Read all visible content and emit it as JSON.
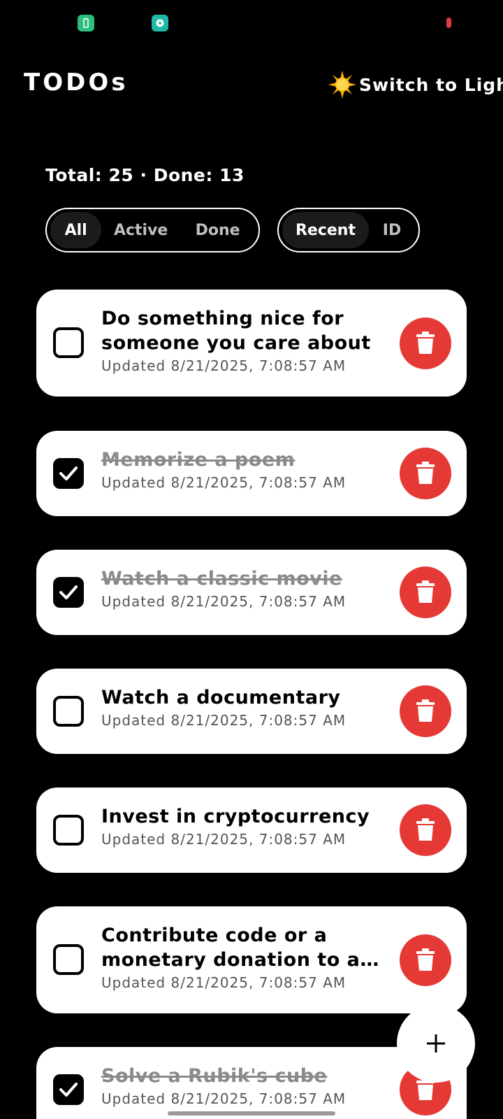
{
  "header": {
    "title": "TODOs",
    "theme_toggle_label": "Switch to Ligh"
  },
  "summary": {
    "stats": "Total: 25 · Done: 13"
  },
  "filters": {
    "all": "All",
    "active": "Active",
    "done": "Done",
    "selected": "All"
  },
  "sort": {
    "recent": "Recent",
    "id": "ID",
    "selected": "Recent"
  },
  "todos": [
    {
      "title": "Do something nice for someone you care about",
      "updated": "Updated 8/21/2025, 7:08:57 AM",
      "done": false
    },
    {
      "title": "Memorize a poem",
      "updated": "Updated 8/21/2025, 7:08:57 AM",
      "done": true
    },
    {
      "title": "Watch a classic movie",
      "updated": "Updated 8/21/2025, 7:08:57 AM",
      "done": true
    },
    {
      "title": "Watch a documentary",
      "updated": "Updated 8/21/2025, 7:08:57 AM",
      "done": false
    },
    {
      "title": "Invest in cryptocurrency",
      "updated": "Updated 8/21/2025, 7:08:57 AM",
      "done": false
    },
    {
      "title": "Contribute code or a monetary donation to an open-source software project",
      "updated": "Updated 8/21/2025, 7:08:57 AM",
      "done": false
    },
    {
      "title": "Solve a Rubik's cube",
      "updated": "Updated 8/21/2025, 7:08:57 AM",
      "done": true
    }
  ],
  "icons": {
    "theme": "sun-icon",
    "delete": "trash-icon",
    "check": "check-icon",
    "add": "plus-icon"
  },
  "colors": {
    "background": "#000000",
    "card": "#ffffff",
    "delete": "#e53935",
    "done_text": "#8a8a8a"
  }
}
